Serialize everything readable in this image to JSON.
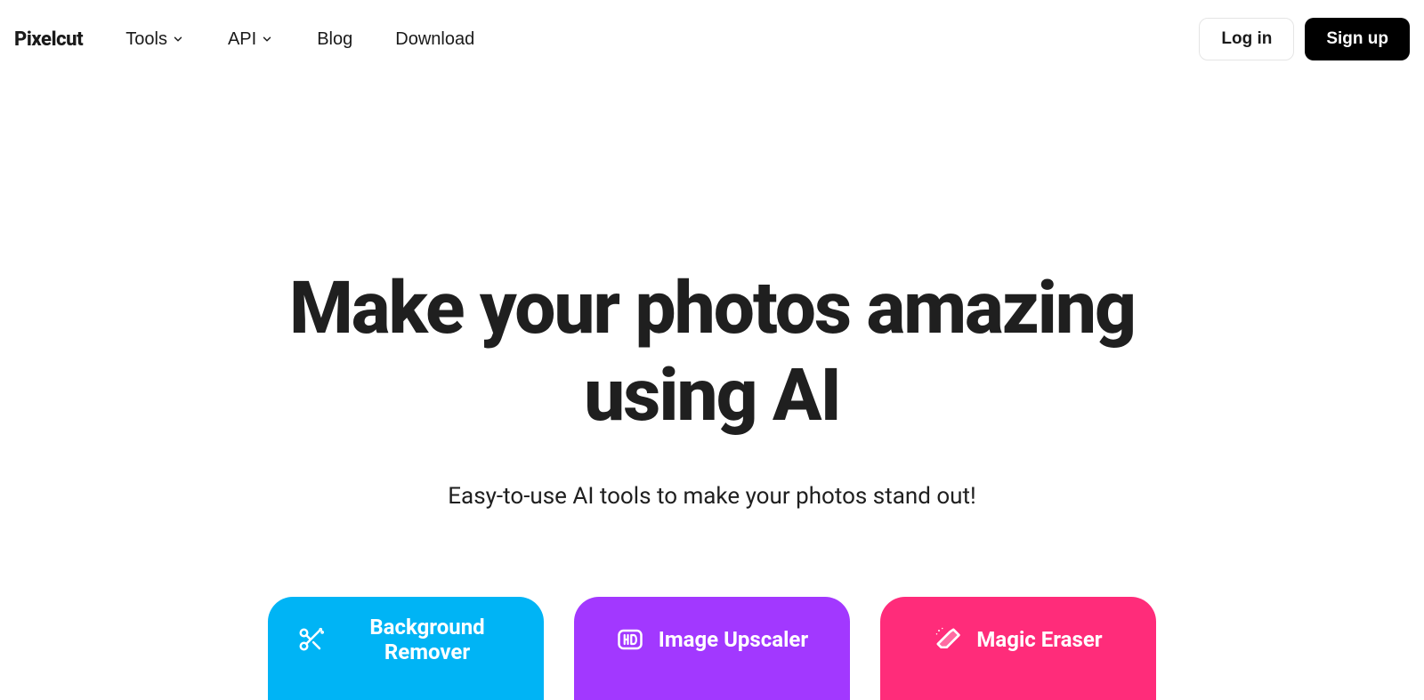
{
  "header": {
    "logo": "Pixelcut",
    "nav": {
      "tools": "Tools",
      "api": "API",
      "blog": "Blog",
      "download": "Download"
    },
    "login": "Log in",
    "signup": "Sign up"
  },
  "hero": {
    "title": "Make your photos amazing using AI",
    "subtitle": "Easy-to-use AI tools to make your photos stand out!"
  },
  "cards": {
    "bg_remover": "Background Remover",
    "upscaler": "Image Upscaler",
    "eraser": "Magic Eraser"
  }
}
